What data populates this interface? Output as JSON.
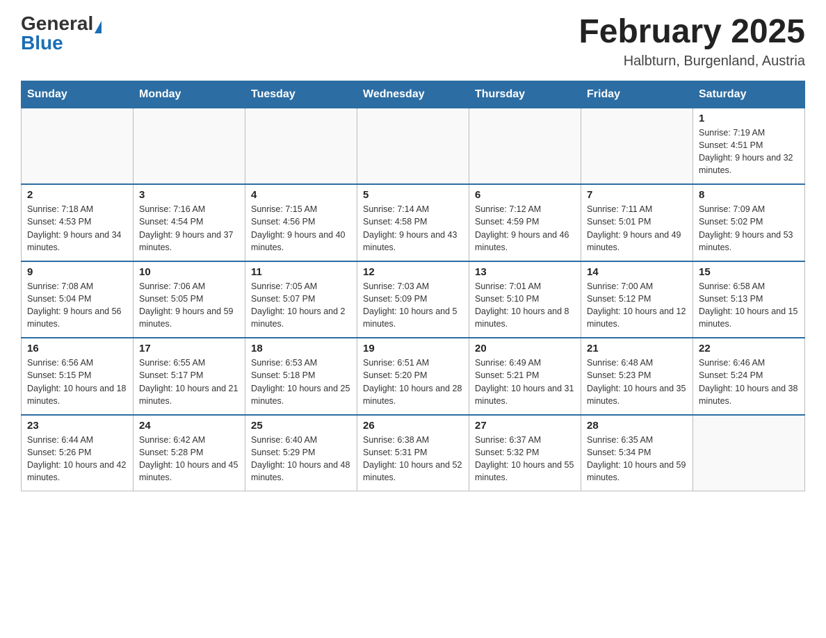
{
  "header": {
    "logo_general": "General",
    "logo_blue": "Blue",
    "month_title": "February 2025",
    "location": "Halbturn, Burgenland, Austria"
  },
  "weekdays": [
    "Sunday",
    "Monday",
    "Tuesday",
    "Wednesday",
    "Thursday",
    "Friday",
    "Saturday"
  ],
  "weeks": [
    [
      {
        "day": "",
        "info": ""
      },
      {
        "day": "",
        "info": ""
      },
      {
        "day": "",
        "info": ""
      },
      {
        "day": "",
        "info": ""
      },
      {
        "day": "",
        "info": ""
      },
      {
        "day": "",
        "info": ""
      },
      {
        "day": "1",
        "info": "Sunrise: 7:19 AM\nSunset: 4:51 PM\nDaylight: 9 hours and 32 minutes."
      }
    ],
    [
      {
        "day": "2",
        "info": "Sunrise: 7:18 AM\nSunset: 4:53 PM\nDaylight: 9 hours and 34 minutes."
      },
      {
        "day": "3",
        "info": "Sunrise: 7:16 AM\nSunset: 4:54 PM\nDaylight: 9 hours and 37 minutes."
      },
      {
        "day": "4",
        "info": "Sunrise: 7:15 AM\nSunset: 4:56 PM\nDaylight: 9 hours and 40 minutes."
      },
      {
        "day": "5",
        "info": "Sunrise: 7:14 AM\nSunset: 4:58 PM\nDaylight: 9 hours and 43 minutes."
      },
      {
        "day": "6",
        "info": "Sunrise: 7:12 AM\nSunset: 4:59 PM\nDaylight: 9 hours and 46 minutes."
      },
      {
        "day": "7",
        "info": "Sunrise: 7:11 AM\nSunset: 5:01 PM\nDaylight: 9 hours and 49 minutes."
      },
      {
        "day": "8",
        "info": "Sunrise: 7:09 AM\nSunset: 5:02 PM\nDaylight: 9 hours and 53 minutes."
      }
    ],
    [
      {
        "day": "9",
        "info": "Sunrise: 7:08 AM\nSunset: 5:04 PM\nDaylight: 9 hours and 56 minutes."
      },
      {
        "day": "10",
        "info": "Sunrise: 7:06 AM\nSunset: 5:05 PM\nDaylight: 9 hours and 59 minutes."
      },
      {
        "day": "11",
        "info": "Sunrise: 7:05 AM\nSunset: 5:07 PM\nDaylight: 10 hours and 2 minutes."
      },
      {
        "day": "12",
        "info": "Sunrise: 7:03 AM\nSunset: 5:09 PM\nDaylight: 10 hours and 5 minutes."
      },
      {
        "day": "13",
        "info": "Sunrise: 7:01 AM\nSunset: 5:10 PM\nDaylight: 10 hours and 8 minutes."
      },
      {
        "day": "14",
        "info": "Sunrise: 7:00 AM\nSunset: 5:12 PM\nDaylight: 10 hours and 12 minutes."
      },
      {
        "day": "15",
        "info": "Sunrise: 6:58 AM\nSunset: 5:13 PM\nDaylight: 10 hours and 15 minutes."
      }
    ],
    [
      {
        "day": "16",
        "info": "Sunrise: 6:56 AM\nSunset: 5:15 PM\nDaylight: 10 hours and 18 minutes."
      },
      {
        "day": "17",
        "info": "Sunrise: 6:55 AM\nSunset: 5:17 PM\nDaylight: 10 hours and 21 minutes."
      },
      {
        "day": "18",
        "info": "Sunrise: 6:53 AM\nSunset: 5:18 PM\nDaylight: 10 hours and 25 minutes."
      },
      {
        "day": "19",
        "info": "Sunrise: 6:51 AM\nSunset: 5:20 PM\nDaylight: 10 hours and 28 minutes."
      },
      {
        "day": "20",
        "info": "Sunrise: 6:49 AM\nSunset: 5:21 PM\nDaylight: 10 hours and 31 minutes."
      },
      {
        "day": "21",
        "info": "Sunrise: 6:48 AM\nSunset: 5:23 PM\nDaylight: 10 hours and 35 minutes."
      },
      {
        "day": "22",
        "info": "Sunrise: 6:46 AM\nSunset: 5:24 PM\nDaylight: 10 hours and 38 minutes."
      }
    ],
    [
      {
        "day": "23",
        "info": "Sunrise: 6:44 AM\nSunset: 5:26 PM\nDaylight: 10 hours and 42 minutes."
      },
      {
        "day": "24",
        "info": "Sunrise: 6:42 AM\nSunset: 5:28 PM\nDaylight: 10 hours and 45 minutes."
      },
      {
        "day": "25",
        "info": "Sunrise: 6:40 AM\nSunset: 5:29 PM\nDaylight: 10 hours and 48 minutes."
      },
      {
        "day": "26",
        "info": "Sunrise: 6:38 AM\nSunset: 5:31 PM\nDaylight: 10 hours and 52 minutes."
      },
      {
        "day": "27",
        "info": "Sunrise: 6:37 AM\nSunset: 5:32 PM\nDaylight: 10 hours and 55 minutes."
      },
      {
        "day": "28",
        "info": "Sunrise: 6:35 AM\nSunset: 5:34 PM\nDaylight: 10 hours and 59 minutes."
      },
      {
        "day": "",
        "info": ""
      }
    ]
  ]
}
